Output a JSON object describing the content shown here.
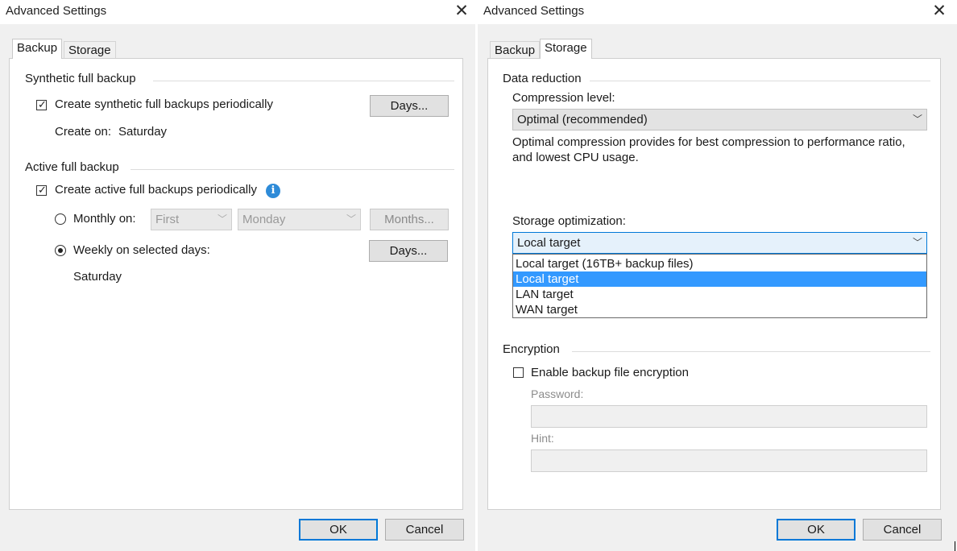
{
  "left_dialog": {
    "title": "Advanced Settings",
    "tabs": [
      {
        "label": "Backup",
        "active": true
      },
      {
        "label": "Storage",
        "active": false
      }
    ],
    "synthetic": {
      "group_label": "Synthetic full backup",
      "checkbox_label": "Create synthetic full backups periodically",
      "checked": true,
      "days_button": "Days...",
      "create_on_label": "Create on:",
      "create_on_value": "Saturday"
    },
    "active": {
      "group_label": "Active full backup",
      "checkbox_label": "Create active full backups periodically",
      "checked": true,
      "info_icon": "info-icon",
      "monthly_label": "Monthly on:",
      "monthly_selected": false,
      "monthly_week": "First",
      "monthly_day": "Monday",
      "months_button": "Months...",
      "weekly_label": "Weekly on selected days:",
      "weekly_selected": true,
      "days_button": "Days...",
      "weekly_value": "Saturday"
    },
    "ok_label": "OK",
    "cancel_label": "Cancel"
  },
  "right_dialog": {
    "title": "Advanced Settings",
    "tabs": [
      {
        "label": "Backup",
        "active": false
      },
      {
        "label": "Storage",
        "active": true
      }
    ],
    "data_reduction": {
      "group_label": "Data reduction",
      "compression_label": "Compression level:",
      "compression_value": "Optimal (recommended)",
      "description_line1": "Optimal compression provides for best compression to performance ratio,",
      "description_line2": "and lowest CPU usage.",
      "storage_opt_label": "Storage optimization:",
      "storage_opt_value": "Local target",
      "storage_opt_options": [
        {
          "label": "Local target (16TB+ backup files)",
          "selected": false
        },
        {
          "label": "Local target",
          "selected": true
        },
        {
          "label": "LAN target",
          "selected": false
        },
        {
          "label": "WAN target",
          "selected": false
        }
      ]
    },
    "encryption": {
      "group_label": "Encryption",
      "checkbox_label": "Enable backup file encryption",
      "checked": false,
      "password_label": "Password:",
      "password_value": "",
      "hint_label": "Hint:",
      "hint_value": ""
    },
    "ok_label": "OK",
    "cancel_label": "Cancel"
  },
  "icons": {
    "close": "close-icon",
    "chevron": "chevron-down-icon",
    "info": "info-icon"
  },
  "colors": {
    "accent": "#0078d7",
    "selection": "#3399ff",
    "dialog_bg": "#f0f0f0"
  }
}
